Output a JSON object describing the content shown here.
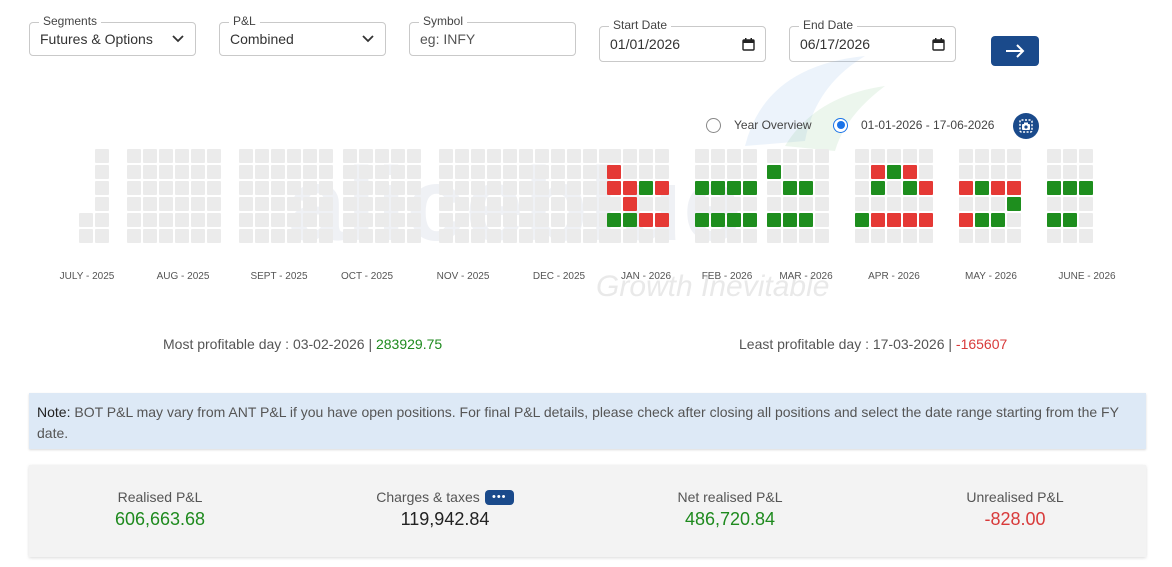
{
  "filters": {
    "segments": {
      "label": "Segments",
      "value": "Futures & Options"
    },
    "pnl": {
      "label": "P&L",
      "value": "Combined"
    },
    "symbol": {
      "label": "Symbol",
      "placeholder": "eg: INFY",
      "value": ""
    },
    "start_date": {
      "label": "Start Date",
      "value": "01/01/2026"
    },
    "end_date": {
      "label": "End Date",
      "value": "06/17/2026"
    }
  },
  "watermark": {
    "text": "aliceblue",
    "tagline": "Growth Inevitable"
  },
  "view": {
    "year_overview": "Year Overview",
    "range": "01-01-2026 - 17-06-2026",
    "selected": "range"
  },
  "colors": {
    "profit": "#1e8e1e",
    "loss": "#e53935",
    "empty": "#ebebeb",
    "accent": "#1a4a8b"
  },
  "months": [
    "JULY - 2025",
    "AUG - 2025",
    "SEPT - 2025",
    "OCT - 2025",
    "NOV - 2025",
    "DEC - 2025",
    "JAN - 2026",
    "FEB - 2026",
    "MAR - 2026",
    "APR - 2026",
    "MAY - 2026",
    "JUNE - 2026"
  ],
  "stats": {
    "most_profitable_label": "Most profitable day : 03-02-2026 |",
    "most_profitable_value": "283929.75",
    "least_profitable_label": "Least profitable day : 17-03-2026 |",
    "least_profitable_value": "-165607"
  },
  "note": {
    "prefix": "Note:",
    "text": "BOT P&L may vary from ANT P&L if you have open positions. For final P&L details, please check after closing all positions and select the date range starting from the FY date."
  },
  "summary": {
    "realised": {
      "label": "Realised P&L",
      "value": "606,663.68"
    },
    "charges": {
      "label": "Charges & taxes",
      "value": "119,942.84",
      "more": "•••"
    },
    "net_realised": {
      "label": "Net realised P&L",
      "value": "486,720.84"
    },
    "unrealised": {
      "label": "Unrealised P&L",
      "value": "-828.00"
    }
  }
}
